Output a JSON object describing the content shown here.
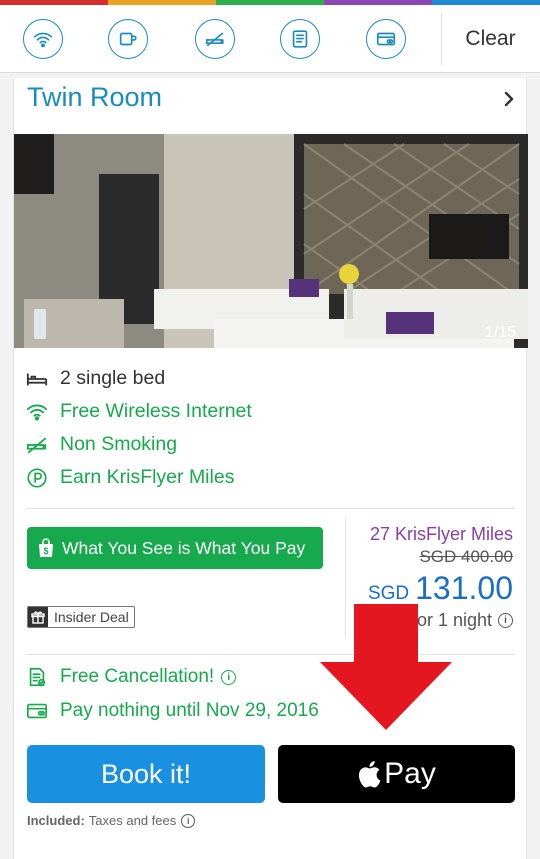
{
  "colors": {
    "rainbow": [
      "#d62d2d",
      "#e8a325",
      "#2fae4e",
      "#8a46b2",
      "#1f8ad0"
    ],
    "accent": "#1a8bbf",
    "green": "#17a94d",
    "purple": "#8a3fa3",
    "price_blue": "#1a6fc4",
    "book_button": "#1a91e0",
    "arrow_red": "#e4161f"
  },
  "filter_bar": {
    "icons": [
      "wifi-icon",
      "coffee-cup-icon",
      "no-smoking-icon",
      "document-icon",
      "credit-card-icon"
    ],
    "clear_label": "Clear"
  },
  "room": {
    "title": "Twin Room",
    "photo_counter": "1/15",
    "amenities": [
      {
        "icon": "bed-icon",
        "label": "2 single bed"
      },
      {
        "icon": "wifi-icon",
        "label": "Free Wireless Internet"
      },
      {
        "icon": "no-smoking-icon",
        "label": "Non Smoking"
      },
      {
        "icon": "krisflyer-icon",
        "label": "Earn KrisFlyer Miles"
      }
    ]
  },
  "deal": {
    "wysiwyg_label": "What You See is What You Pay",
    "insider_label": "Insider Deal"
  },
  "pricing": {
    "miles": "27 KrisFlyer Miles",
    "old_price": "SGD 400.00",
    "currency": "SGD",
    "price": "131.00",
    "per_night": "or 1 night"
  },
  "policies": {
    "cancellation": "Free Cancellation!",
    "pay_later": "Pay nothing until Nov 29, 2016"
  },
  "actions": {
    "book_label": "Book it!",
    "apple_pay_label": "Pay"
  },
  "included": {
    "prefix": "Included:",
    "text": "Taxes and fees"
  }
}
